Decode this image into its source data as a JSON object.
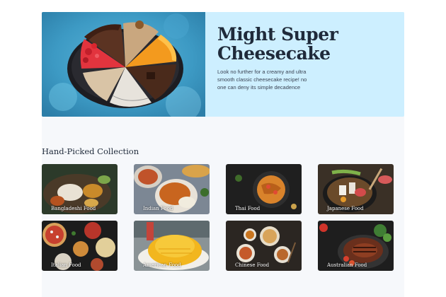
{
  "hero": {
    "title_line1": "Might Super",
    "title_line2": "Cheesecake",
    "description": "Look no further for a creamy and ultra smooth classic cheesecake recipe! no one can deny its simple decadence",
    "background_color": "#cdefff"
  },
  "collection": {
    "title": "Hand-Picked Collection",
    "cards": [
      {
        "label": "Bangladeshi Food"
      },
      {
        "label": "Indian Food"
      },
      {
        "label": "Thai Food"
      },
      {
        "label": "Japanese Food"
      },
      {
        "label": "Italian Food"
      },
      {
        "label": "American Food"
      },
      {
        "label": "Chinese Food"
      },
      {
        "label": "Australian Food"
      }
    ]
  },
  "colors": {
    "title_text": "#1f2a3a",
    "page_background": "#f6f8fb"
  }
}
